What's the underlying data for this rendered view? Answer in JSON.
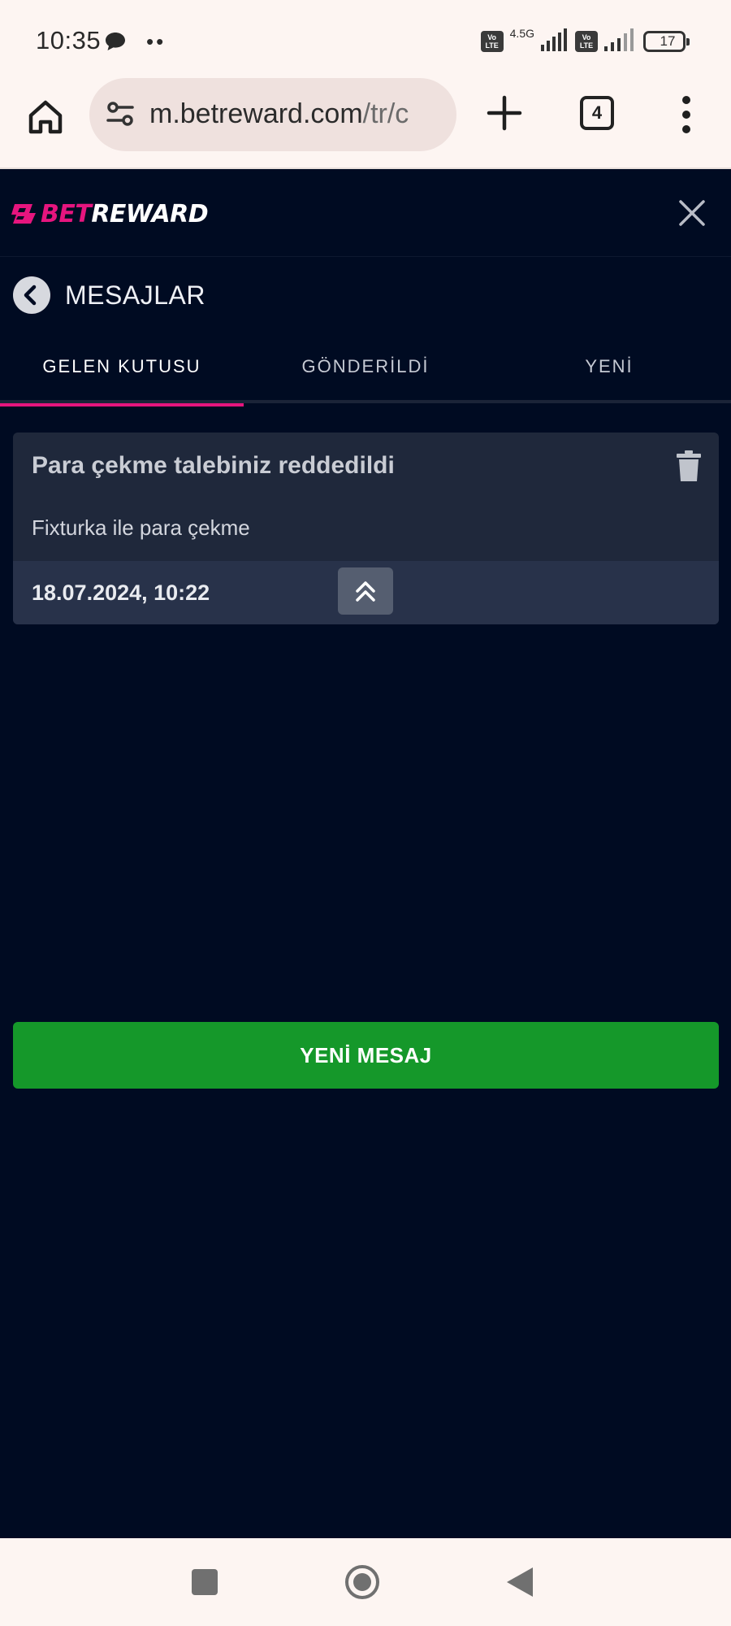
{
  "status_bar": {
    "time": "10:35",
    "dots": "••",
    "network_label": "4.5G",
    "volte_label": "Vo LTE",
    "battery": "17"
  },
  "browser": {
    "url_main": "m.betreward.com",
    "url_path": "/tr/c",
    "tab_count": "4"
  },
  "site": {
    "logo_bet": "BET",
    "logo_reward": "REWARD"
  },
  "page": {
    "title": "MESAJLAR"
  },
  "tabs": [
    {
      "label": "GELEN KUTUSU",
      "active": true
    },
    {
      "label": "GÖNDERİLDİ",
      "active": false
    },
    {
      "label": "YENİ",
      "active": false
    }
  ],
  "messages": [
    {
      "subject": "Para çekme talebiniz reddedildi",
      "body": "Fixturka ile para çekme",
      "date": "18.07.2024, 10:22"
    }
  ],
  "actions": {
    "new_message_label": "YENİ MESAJ"
  },
  "colors": {
    "page_bg": "#000b22",
    "accent_pink": "#e6157e",
    "card_bg": "#1f283b",
    "button_green": "#15982a"
  },
  "icons": {
    "status": [
      "message-bubble-icon",
      "volte-icon",
      "signal-icon",
      "battery-icon"
    ],
    "browser": [
      "home-icon",
      "site-settings-icon",
      "plus-icon",
      "tabs-icon",
      "more-vert-icon"
    ],
    "app": [
      "close-icon",
      "back-arrow-icon",
      "trash-icon",
      "chevron-double-up-icon"
    ]
  }
}
